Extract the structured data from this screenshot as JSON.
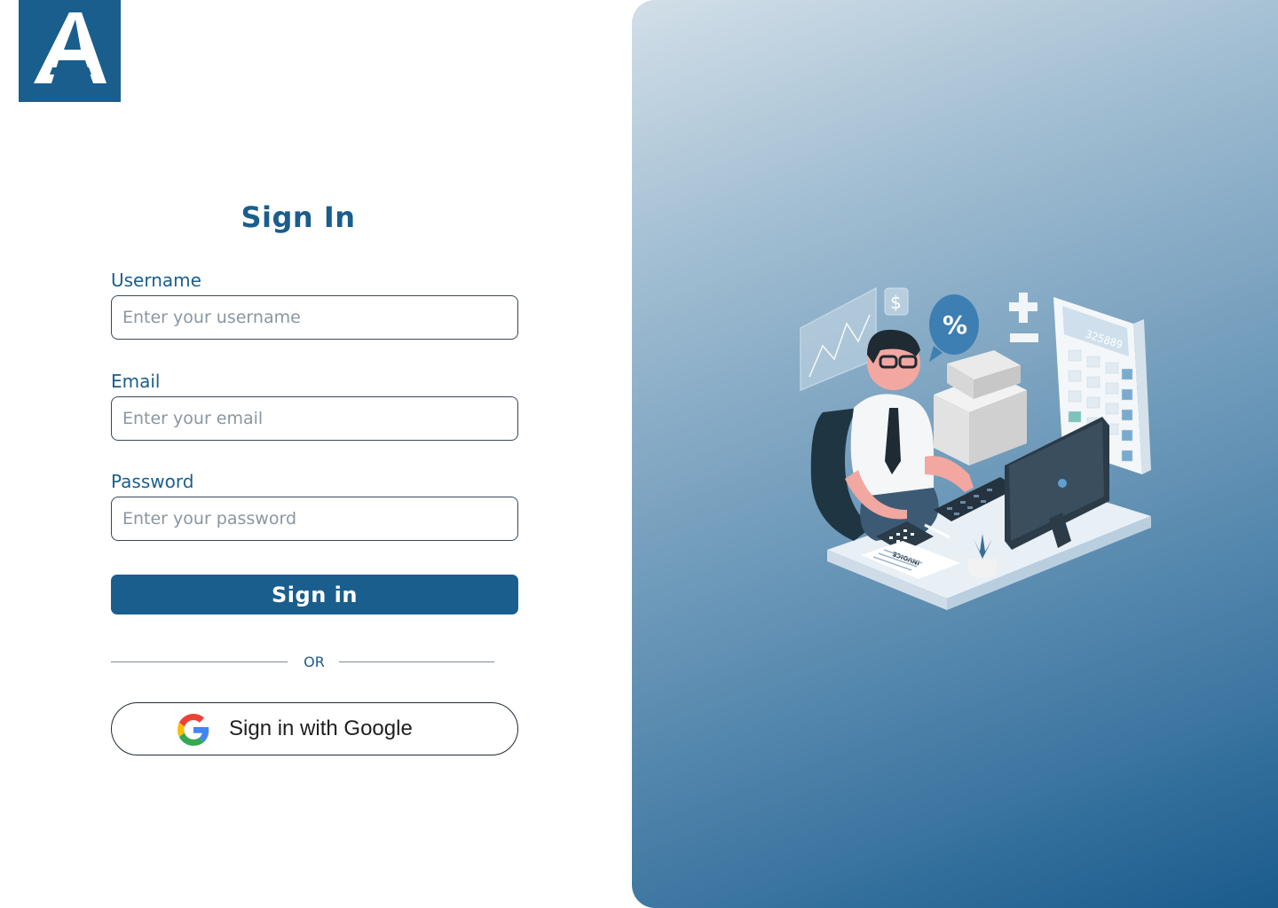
{
  "brand": {
    "color": "#1a5e8d",
    "logo_icon": "a-letter-logo-icon"
  },
  "form": {
    "title": "Sign In",
    "username": {
      "label": "Username",
      "placeholder": "Enter your username",
      "value": ""
    },
    "email": {
      "label": "Email",
      "placeholder": "Enter your email",
      "value": ""
    },
    "password": {
      "label": "Password",
      "placeholder": "Enter your password",
      "value": ""
    },
    "submit_label": "Sign in",
    "divider_text": "OR",
    "google_label": "Sign in with Google",
    "google_icon": "google-g-icon"
  },
  "illustration": {
    "name": "accountant-at-desk-illustration",
    "calculator_readout": "325889",
    "invoice_label": "INVOICE",
    "bubble_symbol": "%",
    "currency_symbol": "$"
  },
  "colors": {
    "hero_gradient_start": "#d2dfe8",
    "hero_gradient_end": "#1a5b8c",
    "button": "#1a5e8d"
  }
}
